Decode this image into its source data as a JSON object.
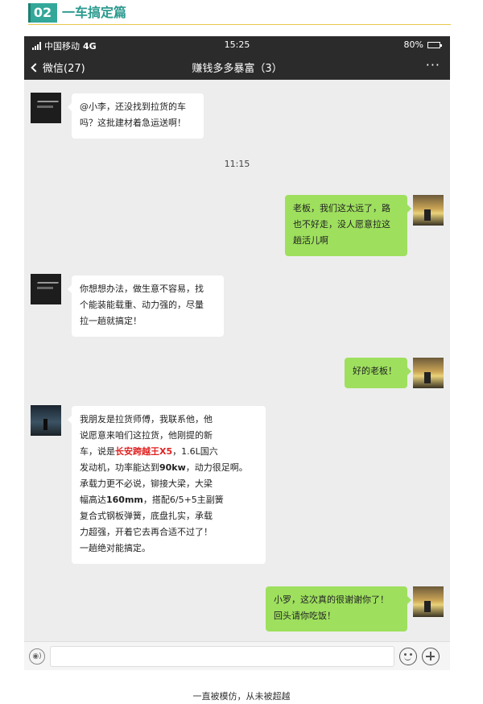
{
  "section": {
    "number": "02",
    "title": "一车搞定篇"
  },
  "statusbar": {
    "carrier": "中国移动",
    "network": "4G",
    "time": "15:25",
    "battery": "80%",
    "battery_level": 0.8
  },
  "navbar": {
    "back_label": "微信(27)",
    "title": "赚钱多多暴富（3）",
    "more": "···"
  },
  "messages": [
    {
      "side": "in",
      "lines": [
        "@小李，还没找到拉货的车",
        "吗？这批建材着急运送啊！"
      ]
    },
    {
      "side": "out",
      "lines": [
        "老板，我们这太远了，路",
        "也不好走，没人愿意拉这",
        "趟活儿啊"
      ]
    },
    {
      "side": "in",
      "lines": [
        "你想想办法，做生意不容易，找",
        "个能装能载重、动力强的，尽量",
        "拉一趟就搞定！"
      ]
    },
    {
      "side": "out",
      "lines": [
        "好的老板！"
      ]
    },
    {
      "side": "in",
      "line1": "我朋友是拉货师傅，我联系他，他",
      "line2": "说愿意来咱们这拉货，他刚提的新",
      "line3_pre": "车，说是",
      "line3_hl": "长安跨越王X5",
      "line3_post": "，1.6L国六",
      "line4_pre": "发动机，功率能达到",
      "line4_bold": "90kw",
      "line4_post": "，动力很足啊。",
      "line5": "承载力更不必说，铆接大梁，大梁",
      "line6_pre": "幅高达",
      "line6_bold": "160mm",
      "line6_post": "，搭配6/5+5主副簧",
      "line7": "复合式钢板弹簧，底盘扎实，承载",
      "line8": "力超强，开着它去再合适不过了！",
      "line9": "一趟绝对能搞定。"
    },
    {
      "side": "out",
      "lines": [
        "小罗，这次真的很谢谢你了！",
        "回头请你吃饭！"
      ]
    }
  ],
  "timestamp": "11:15",
  "inputbar": {
    "voice": "◉)"
  },
  "footer": "一直被模仿，从未被超越"
}
